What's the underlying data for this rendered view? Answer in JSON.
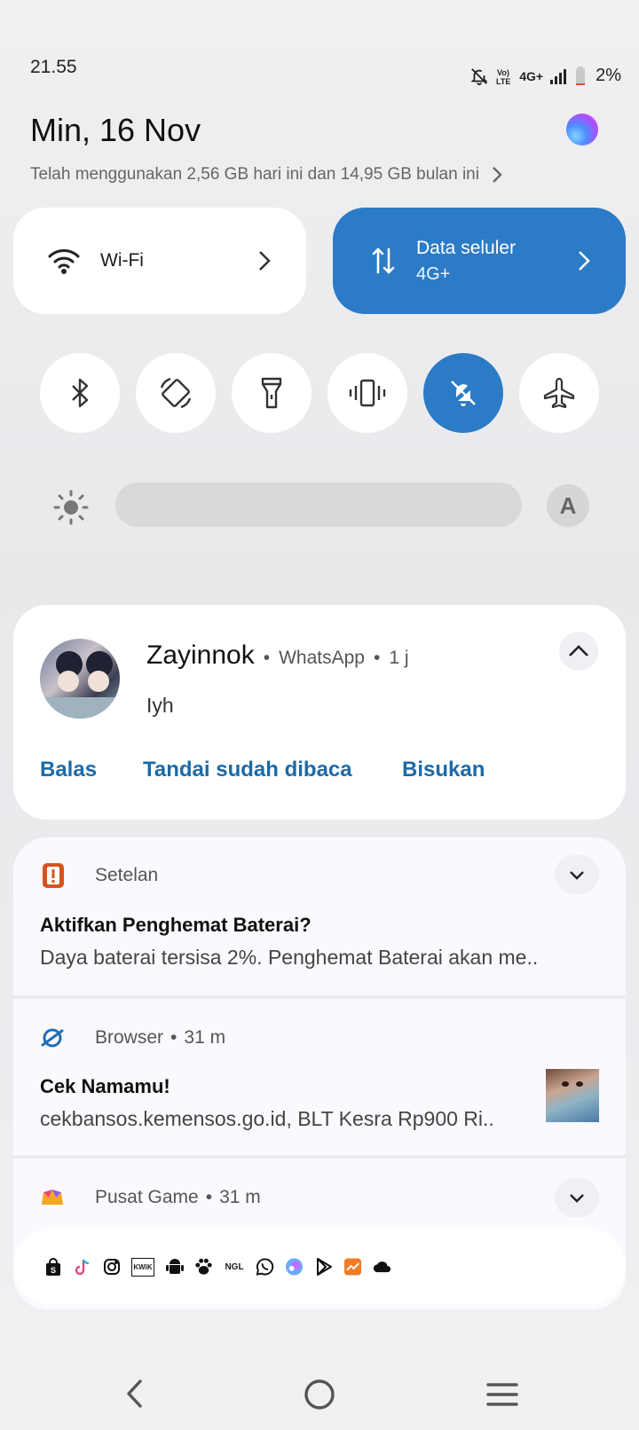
{
  "status": {
    "time": "21.55",
    "volte": "VoLTE",
    "network": "4G+",
    "battery": "2%"
  },
  "header": {
    "date": "Min, 16 Nov",
    "data_usage": "Telah menggunakan 2,56 GB hari ini dan 14,95 GB bulan ini"
  },
  "tiles": {
    "wifi": {
      "label": "Wi-Fi"
    },
    "data": {
      "label": "Data seluler",
      "sub": "4G+"
    }
  },
  "toggles": [
    {
      "name": "bluetooth-icon",
      "active": false
    },
    {
      "name": "auto-rotate-icon",
      "active": false
    },
    {
      "name": "flashlight-icon",
      "active": false
    },
    {
      "name": "vibrate-icon",
      "active": false
    },
    {
      "name": "silent-bell-icon",
      "active": true
    },
    {
      "name": "airplane-icon",
      "active": false
    }
  ],
  "brightness": {
    "auto_label": "A"
  },
  "whatsapp": {
    "sender": "Zayinnok",
    "app": "WhatsApp",
    "time": "1 j",
    "message": "Iyh",
    "actions": {
      "reply": "Balas",
      "mark_read": "Tandai sudah dibaca",
      "mute": "Bisukan"
    }
  },
  "notif_settings": {
    "app": "Setelan",
    "title": "Aktifkan Penghemat Baterai?",
    "body": "Daya baterai tersisa 2%. Penghemat Baterai akan me.."
  },
  "notif_browser": {
    "app": "Browser",
    "time": "31 m",
    "title": "Cek Namamu!",
    "body": "cekbansos.kemensos.go.id, BLT Kesra Rp900 Ri.."
  },
  "notif_game": {
    "app": "Pusat Game",
    "time": "31 m"
  },
  "shortcuts": {
    "kwik_label": "KWiK",
    "ngl_label": "NGL"
  },
  "colors": {
    "accent": "#2b7bc6",
    "link": "#1b6aa8"
  }
}
